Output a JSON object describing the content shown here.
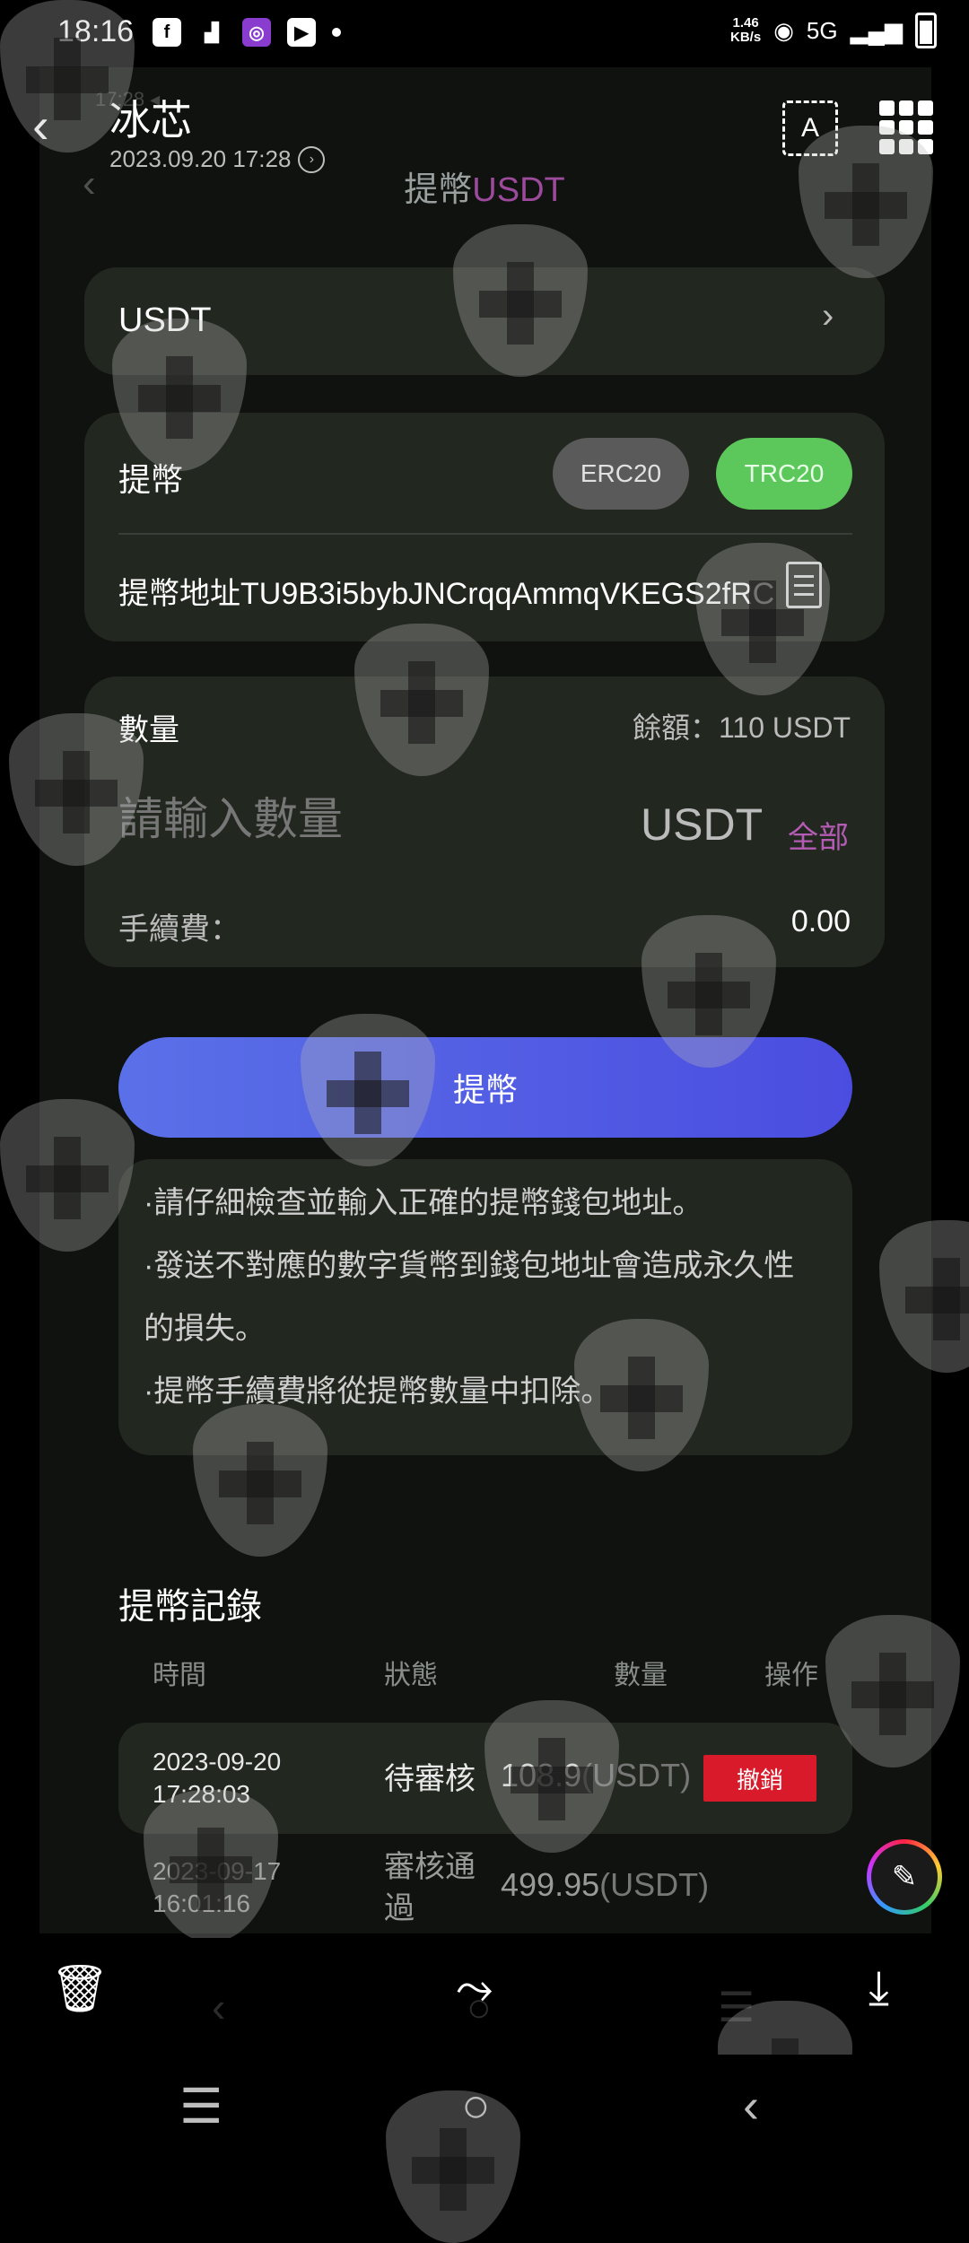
{
  "status_bar": {
    "time": "18:16",
    "speed": "1.46",
    "speed_unit": "KB/s",
    "network": "5G",
    "icons": [
      "facebook-icon",
      "signal-stats-icon",
      "app-badge-icon",
      "youtube-icon",
      "dot-icon",
      "hotspot-icon",
      "cell-signal-icon",
      "battery-icon"
    ]
  },
  "viewer": {
    "title": "冰芯",
    "date": "2023.09.20 17:28",
    "back_label": "‹"
  },
  "page": {
    "title_prefix": "提幣",
    "title_accent": "USDT",
    "currency_label": "USDT",
    "withdraw_label": "提幣",
    "chain_options": [
      "ERC20",
      "TRC20"
    ],
    "selected_chain": "TRC20",
    "address_text": "提幣地址TU9B3i5bybJNCrqqAmmqVKEGS2fRC",
    "amount_label": "數量",
    "balance_text": "餘額：110 USDT",
    "amount_placeholder": "請輸入數量",
    "amount_unit": "USDT",
    "all_label": "全部",
    "fee_label": "手續費：",
    "fee_value": "0.00",
    "submit_label": "提幣",
    "notes": [
      "·請仔細檢查並輸入正確的提幣錢包地址。",
      "·發送不對應的數字貨幣到錢包地址會造成永久性",
      "的損失。",
      "·提幣手續費將從提幣數量中扣除。"
    ]
  },
  "records": {
    "title": "提幣記錄",
    "headers": [
      "時間",
      "狀態",
      "數量",
      "操作"
    ],
    "rows": [
      {
        "date": "2023-09-20",
        "time": "17:28:03",
        "status": "待審核",
        "amount": "108.9",
        "unit": "(USDT)",
        "action": "撤銷"
      },
      {
        "date": "2023-09-17",
        "time": "16:01:16",
        "status_line1": "審核通",
        "status_line2": "過",
        "amount": "499.95",
        "unit": "(USDT)"
      }
    ]
  },
  "accent_colors": {
    "trc20": "#5cc85c",
    "submit": "#4f5fe6",
    "cancel": "#d81a2a",
    "all": "#b45cb4"
  }
}
